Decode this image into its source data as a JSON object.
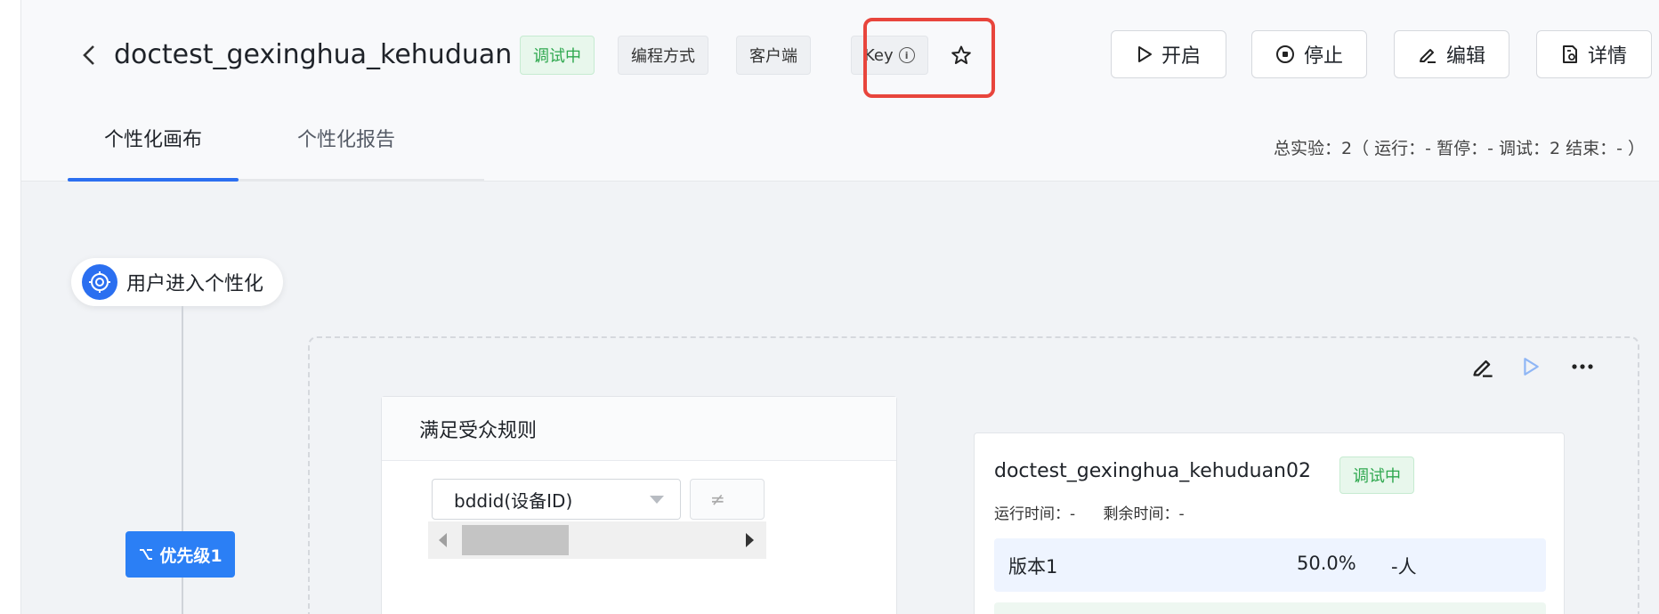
{
  "header": {
    "title": "doctest_gexinghua_kehuduan",
    "status_tag": "调试中",
    "tags": [
      "编程方式",
      "客户端"
    ],
    "key_tag": "Key",
    "info_glyph": "i",
    "actions": {
      "open": "开启",
      "stop": "停止",
      "edit": "编辑",
      "detail": "详情"
    }
  },
  "tabs": [
    {
      "label": "个性化画布",
      "active": true
    },
    {
      "label": "个性化报告",
      "active": false
    }
  ],
  "summary": "总实验：2（ 运行：- 暂停：- 调试：2 结束：- ）",
  "canvas": {
    "entry_label": "用户进入个性化",
    "priority_label": "优先级1",
    "rule_card": {
      "title": "满足受众规则",
      "field_value": "bddid(设备ID)",
      "operator": "≠"
    },
    "experiment": {
      "name": "doctest_gexinghua_kehuduan02",
      "status": "调试中",
      "run_time": "运行时间：-",
      "remain_time": "剩余时间：-",
      "versions": [
        {
          "name": "版本1",
          "percent": "50.0%",
          "people": "-人"
        }
      ]
    }
  },
  "colors": {
    "primary": "#2b6ff0",
    "status_green": "#2fa84f",
    "highlight_red": "#e8453c"
  },
  "icons": [
    "back-arrow-icon",
    "info-icon",
    "star-icon",
    "play-icon",
    "stop-circle-icon",
    "pencil-icon",
    "document-icon",
    "target-icon",
    "branch-icon",
    "more-icon",
    "chevron-down-icon"
  ]
}
